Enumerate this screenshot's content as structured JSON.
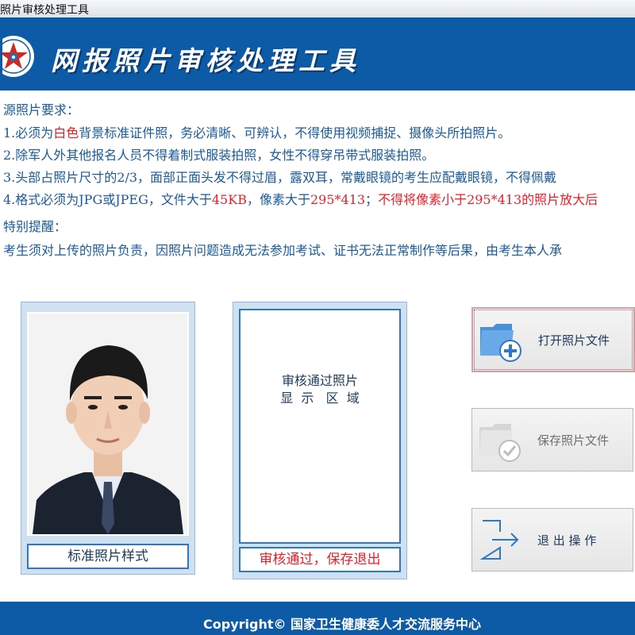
{
  "window": {
    "title": "照片审核处理工具"
  },
  "banner": {
    "title": "网报照片审核处理工具",
    "logo_icon": "emblem-star-logo"
  },
  "requirements": {
    "heading": "源照片要求：",
    "line1_a": "1.必须为",
    "line1_b": "白色",
    "line1_c": "背景标准证件照，务必清晰、可辨认，不得使用视频捕捉、摄像头所拍照片。",
    "line2": "2.除军人外其他报名人员不得着制式服装拍照，女性不得穿吊带式服装拍照。",
    "line3": "3.头部占照片尺寸的2/3，面部正面头发不得过眉，露双耳，常戴眼镜的考生应配戴眼镜，不得佩戴",
    "line4_a": "4.格式必须为JPG或JPEG，文件大于",
    "line4_b": "45KB",
    "line4_c": "，像素大于",
    "line4_d": "295*413",
    "line4_e": "；",
    "line4_f": "不得将像素小于295*413的照片放大后",
    "notice_heading": "特别提醒：",
    "notice_text": "考生须对上传的照片负责，因照片问题造成无法参加考试、证书无法正常制作等后果，由考生本人承"
  },
  "sample": {
    "caption": "标准照片样式",
    "image_desc": "sample-id-photo"
  },
  "preview": {
    "placeholder_line1": "审核通过照片",
    "placeholder_line2": "显  示   区  域",
    "caption": "审核通过，保存退出"
  },
  "buttons": {
    "open_label": "打开照片文件",
    "save_label": "保存照片文件",
    "exit_label": "退 出 操 作"
  },
  "footer": {
    "copyright": "Copyright©  国家卫生健康委人才交流服务中心"
  },
  "colors": {
    "brand_blue": "#0d5aa7",
    "accent_red": "#e8202a",
    "text_blue": "#1a5a9a"
  }
}
